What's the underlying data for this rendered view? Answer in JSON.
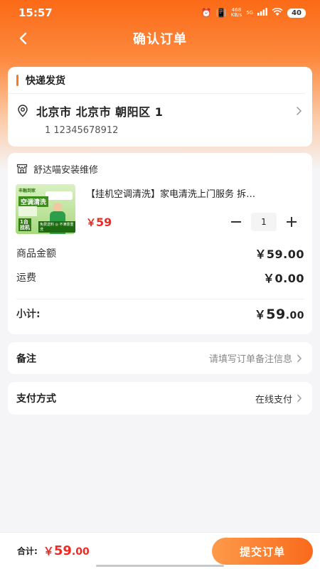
{
  "status_bar": {
    "time": "15:57",
    "network": "468\nKB/s",
    "signal": "5G",
    "battery": "40",
    "icons": [
      "alarm-icon",
      "vibrate-icon",
      "signal-icon",
      "wifi-icon",
      "battery-icon"
    ]
  },
  "nav": {
    "title": "确认订单",
    "back_icon": "chevron-left-icon"
  },
  "address": {
    "section_label": "快递发货",
    "address_line": "北京市 北京市 朝阳区 1",
    "contact": "1 12345678912"
  },
  "order": {
    "shop_name": "舒达喵安装维修",
    "product": {
      "title": "【挂机空调清洗】家电清洗上门服务 拆…",
      "price_symbol": "￥",
      "price": "59",
      "quantity": "1",
      "thumb_text": {
        "brand": "丰融到家",
        "headline": "空调清洗",
        "badge": "1台\n挂机",
        "strip": "免费送料 ◎ 不满意重洗"
      }
    },
    "goods_amount_label": "商品金额",
    "goods_amount": "￥59.00",
    "shipping_label": "运费",
    "shipping": "￥0.00",
    "subtotal_label": "小计:",
    "subtotal_symbol": "￥",
    "subtotal_int": "59",
    "subtotal_dec": ".00"
  },
  "remark": {
    "label": "备注",
    "placeholder": "请填写订单备注信息"
  },
  "payment": {
    "label": "支付方式",
    "value": "在线支付"
  },
  "footer": {
    "total_label": "合计:",
    "total_symbol": "￥",
    "total_int": "59",
    "total_dec": ".00",
    "submit_label": "提交订单"
  },
  "colors": {
    "accent": "#f96a1c",
    "price": "#ee2a24",
    "background": "#f5f5f7"
  }
}
